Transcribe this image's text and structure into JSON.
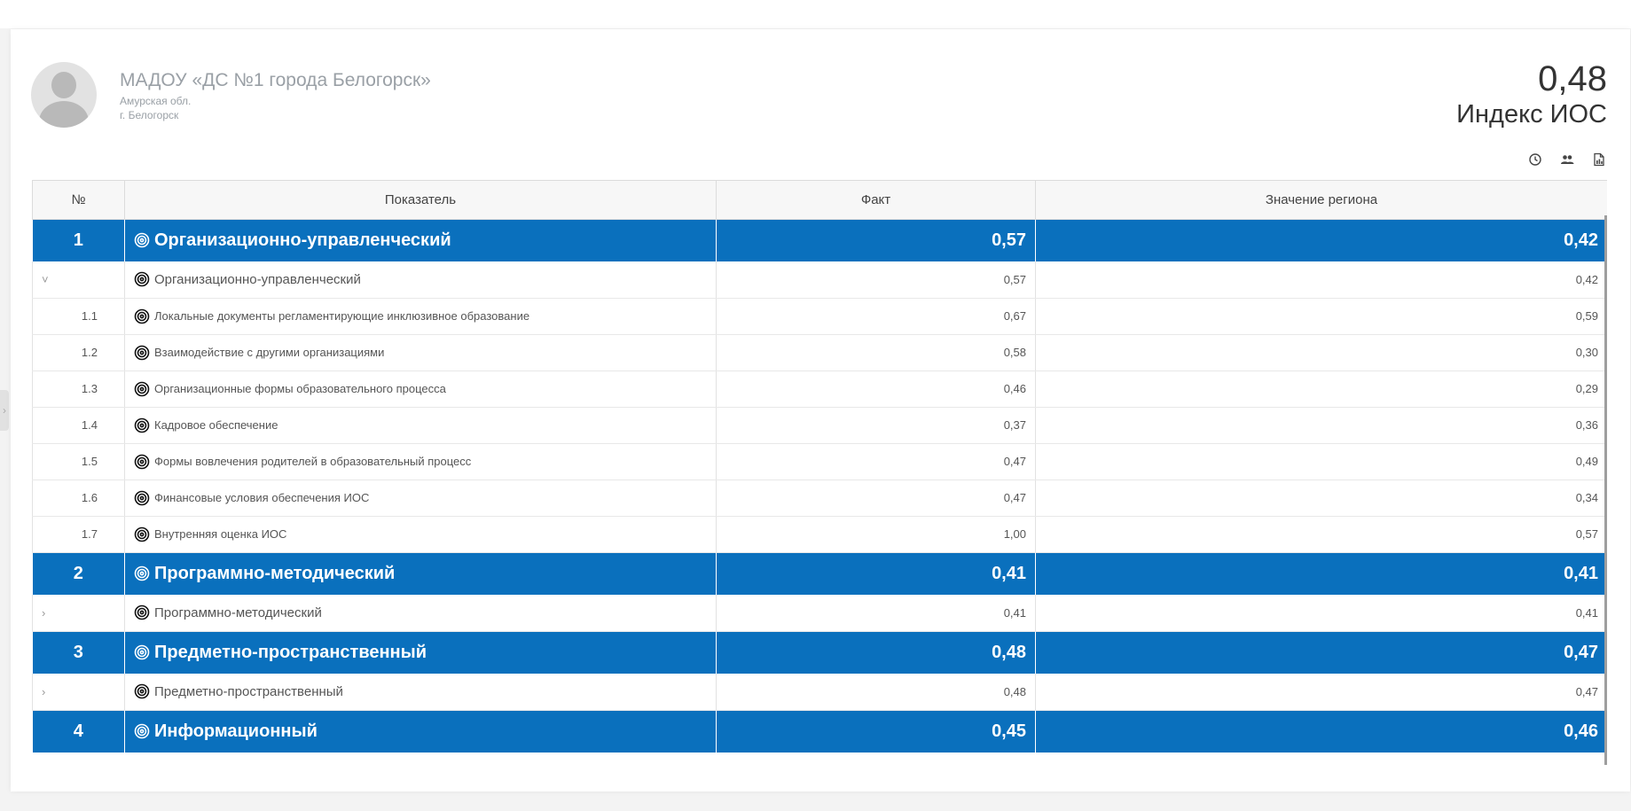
{
  "org": {
    "name": "МАДОУ «ДС №1 города Белогорск»",
    "region": "Амурская обл.",
    "city": "г. Белогорск"
  },
  "index": {
    "value": "0,48",
    "label": "Индекс ИОС"
  },
  "toolbar": {
    "icons": [
      "clock-icon",
      "people-icon",
      "report-icon"
    ]
  },
  "table": {
    "headers": {
      "num": "№",
      "indicator": "Показатель",
      "fact": "Факт",
      "region": "Значение региона"
    },
    "rows": [
      {
        "type": "group",
        "num": "1",
        "name": "Организационно-управленческий",
        "fact": "0,57",
        "region": "0,42"
      },
      {
        "type": "agg",
        "chevron": "˅",
        "name": "Организационно-управленческий",
        "fact": "0,57",
        "region": "0,42"
      },
      {
        "type": "sub",
        "num": "1.1",
        "name": "Локальные документы регламентирующие инклюзивное образование",
        "fact": "0,67",
        "region": "0,59"
      },
      {
        "type": "sub",
        "num": "1.2",
        "name": "Взаимодействие с другими организациями",
        "fact": "0,58",
        "region": "0,30"
      },
      {
        "type": "sub",
        "num": "1.3",
        "name": "Организационные формы образовательного процесса",
        "fact": "0,46",
        "region": "0,29"
      },
      {
        "type": "sub",
        "num": "1.4",
        "name": "Кадровое обеспечение",
        "fact": "0,37",
        "region": "0,36"
      },
      {
        "type": "sub",
        "num": "1.5",
        "name": "Формы вовлечения родителей в образовательный процесс",
        "fact": "0,47",
        "region": "0,49"
      },
      {
        "type": "sub",
        "num": "1.6",
        "name": "Финансовые условия обеспечения ИОС",
        "fact": "0,47",
        "region": "0,34"
      },
      {
        "type": "sub",
        "num": "1.7",
        "name": "Внутренняя оценка ИОС",
        "fact": "1,00",
        "region": "0,57"
      },
      {
        "type": "group",
        "num": "2",
        "name": "Программно-методический",
        "fact": "0,41",
        "region": "0,41"
      },
      {
        "type": "agg",
        "chevron": "›",
        "name": "Программно-методический",
        "fact": "0,41",
        "region": "0,41"
      },
      {
        "type": "group",
        "num": "3",
        "name": "Предметно-пространственный",
        "fact": "0,48",
        "region": "0,47"
      },
      {
        "type": "agg",
        "chevron": "›",
        "name": "Предметно-пространственный",
        "fact": "0,48",
        "region": "0,47"
      },
      {
        "type": "group",
        "num": "4",
        "name": "Информационный",
        "fact": "0,45",
        "region": "0,46"
      }
    ]
  },
  "colors": {
    "group_bg": "#0a70bd",
    "header_bg": "#f7f7f7"
  }
}
